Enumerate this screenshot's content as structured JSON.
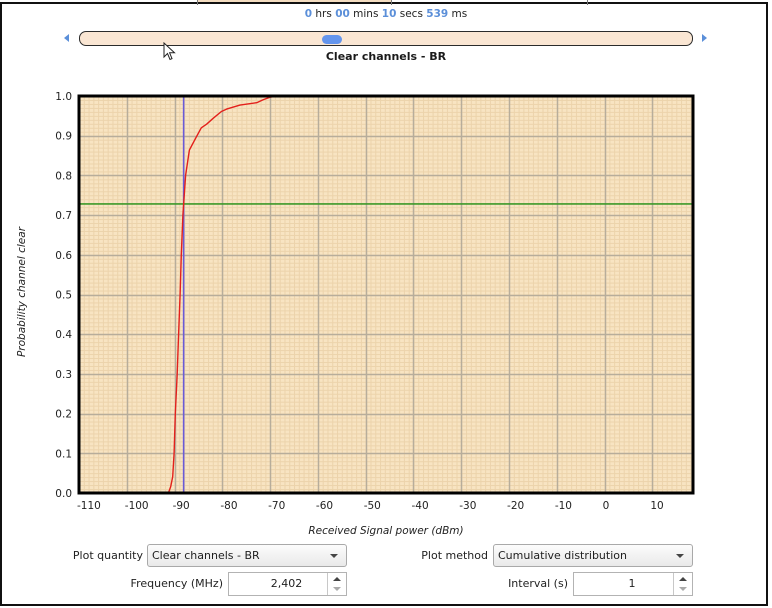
{
  "timestamp": {
    "hours": "0",
    "hours_unit": "hrs",
    "minutes": "00",
    "minutes_unit": "mins",
    "seconds": "10",
    "seconds_unit": "secs",
    "ms": "539",
    "ms_unit": "ms"
  },
  "slider": {
    "position_fraction": 0.41,
    "prev_icon": "triangle-left",
    "next_icon": "triangle-right"
  },
  "chart_data": {
    "type": "line",
    "title": "Clear channels - BR",
    "xlabel": "Received Signal power (dBm)",
    "ylabel": "Probability channel clear",
    "xlim": [
      -110,
      18.5
    ],
    "ylim": [
      0,
      1
    ],
    "grid": true,
    "minor_grid": true,
    "legend": "none",
    "x_ticks": [
      -110,
      -100,
      -90,
      -80,
      -70,
      -60,
      -50,
      -40,
      -30,
      -20,
      -10,
      0,
      10
    ],
    "x_tick_labels": [
      "-110",
      "-100",
      "-90",
      "-80",
      "-70",
      "-60",
      "-50",
      "-40",
      "-30",
      "-20",
      "-10",
      "0",
      "10"
    ],
    "y_ticks": [
      0,
      0.1,
      0.2,
      0.3,
      0.4,
      0.5,
      0.6,
      0.7,
      0.8,
      0.9,
      1.0
    ],
    "y_tick_labels": [
      "0.0",
      "0.1",
      "0.2",
      "0.3",
      "0.4",
      "0.5",
      "0.6",
      "0.7",
      "0.8",
      "0.9",
      "1.0"
    ],
    "series": [
      {
        "name": "Clear channels - BR",
        "color": "#e3201b",
        "x": [
          -91.3,
          -90.8,
          -90.4,
          -90.1,
          -89.85,
          -89.45,
          -89.15,
          -88.85,
          -88.6,
          -88.25,
          -87.7,
          -86.9,
          -85.3,
          -84.4,
          -83.3,
          -81.9,
          -80.2,
          -79.1,
          -76.3,
          -72.8,
          -71.4,
          -70.0,
          -68.6,
          18.5
        ],
        "y": [
          0.0,
          0.016,
          0.041,
          0.1,
          0.2,
          0.3,
          0.4,
          0.5,
          0.6,
          0.7,
          0.8,
          0.864,
          0.9,
          0.92,
          0.929,
          0.944,
          0.961,
          0.967,
          0.977,
          0.983,
          0.991,
          0.997,
          1.0,
          1.0
        ]
      }
    ],
    "reference_lines": {
      "vertical": {
        "x": -88.1,
        "color": "#6a5ad8"
      },
      "horizontal": {
        "y": 0.728,
        "color": "#3d9a2b"
      }
    }
  },
  "controls": {
    "plot_quantity": {
      "label": "Plot quantity",
      "value": "Clear channels - BR"
    },
    "plot_method": {
      "label": "Plot method",
      "value": "Cumulative distribution"
    },
    "frequency": {
      "label": "Frequency (MHz)",
      "value": "2,402"
    },
    "interval": {
      "label": "Interval (s)",
      "value": "1"
    }
  },
  "colors": {
    "accent": "#5b8fd9",
    "slider_handle": "#6495ed",
    "slider_track": "#fae6d3",
    "plot_background": "#f8e4c2",
    "major_grid": "#b7ad9b"
  }
}
